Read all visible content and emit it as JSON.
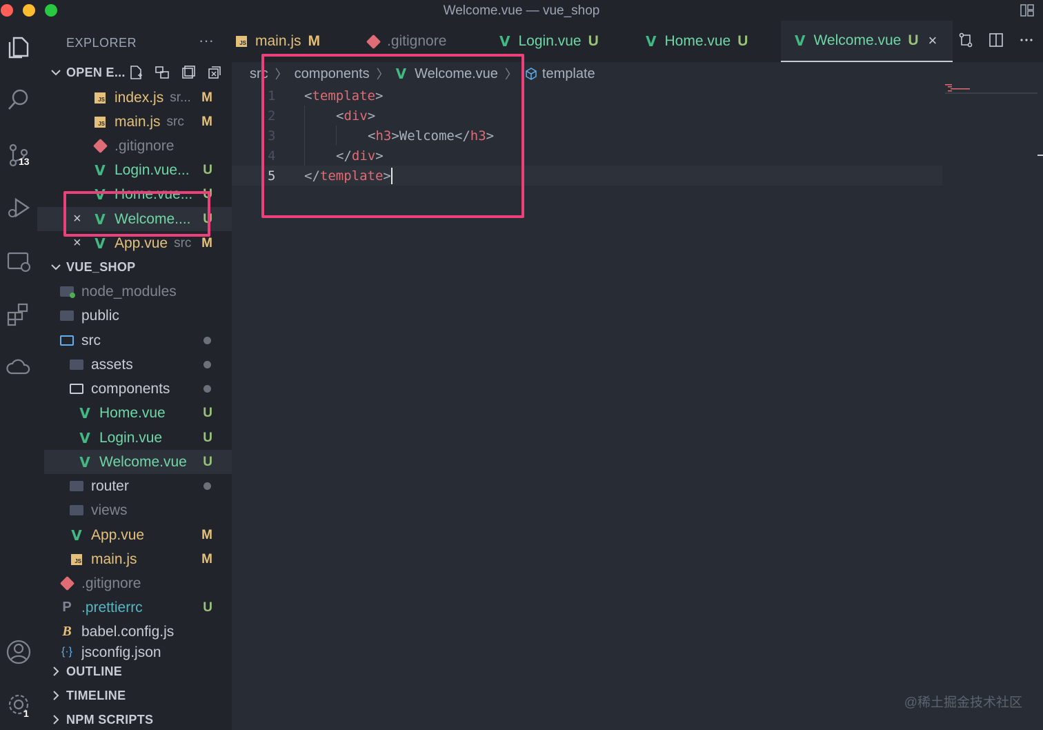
{
  "window": {
    "title": "Welcome.vue — vue_shop"
  },
  "activity_bar": {
    "items": [
      {
        "name": "explorer-icon"
      },
      {
        "name": "search-icon"
      },
      {
        "name": "source-control-icon",
        "badge": "13"
      },
      {
        "name": "run-debug-icon"
      },
      {
        "name": "remote-explorer-icon"
      },
      {
        "name": "extensions-icon"
      },
      {
        "name": "cloud-icon"
      }
    ],
    "bottom": [
      {
        "name": "account-icon"
      },
      {
        "name": "settings-icon",
        "badge": "1"
      }
    ]
  },
  "sidebar": {
    "header": "EXPLORER",
    "more": "···",
    "open_editors": {
      "title": "OPEN E...",
      "items": [
        {
          "label": "index.js",
          "desc": "sr...",
          "status": "M",
          "icon": "js"
        },
        {
          "label": "main.js",
          "desc": "src",
          "status": "M",
          "icon": "js"
        },
        {
          "label": ".gitignore",
          "desc": "",
          "status": "",
          "icon": "git"
        },
        {
          "label": "Login.vue...",
          "desc": "",
          "status": "U",
          "icon": "vue"
        },
        {
          "label": "Home.vue...",
          "desc": "",
          "status": "U",
          "icon": "vue"
        },
        {
          "label": "Welcome....",
          "desc": "",
          "status": "U",
          "icon": "vue",
          "close": "×"
        },
        {
          "label": "App.vue",
          "desc": "src",
          "status": "M",
          "icon": "vue",
          "close": "×"
        }
      ]
    },
    "project": {
      "title": "VUE_SHOP",
      "items": [
        {
          "label": "node_modules",
          "status": ""
        },
        {
          "label": "public",
          "status": ""
        },
        {
          "label": "src",
          "status": "dot"
        },
        {
          "label": "assets",
          "status": "dot"
        },
        {
          "label": "components",
          "status": "dot"
        },
        {
          "label": "Home.vue",
          "status": "U"
        },
        {
          "label": "Login.vue",
          "status": "U"
        },
        {
          "label": "Welcome.vue",
          "status": "U"
        },
        {
          "label": "router",
          "status": "dot"
        },
        {
          "label": "views",
          "status": ""
        },
        {
          "label": "App.vue",
          "status": "M"
        },
        {
          "label": "main.js",
          "status": "M"
        },
        {
          "label": ".gitignore",
          "status": ""
        },
        {
          "label": ".prettierrc",
          "status": "U"
        },
        {
          "label": "babel.config.js",
          "status": ""
        },
        {
          "label": "jsconfig.json",
          "status": ""
        }
      ]
    },
    "outline": "OUTLINE",
    "timeline": "TIMELINE",
    "npm_scripts": "NPM SCRIPTS"
  },
  "tabs": [
    {
      "label": "main.js",
      "status": "M",
      "icon": "js"
    },
    {
      "label": ".gitignore",
      "status": "",
      "icon": "git"
    },
    {
      "label": "Login.vue",
      "status": "U",
      "icon": "vue"
    },
    {
      "label": "Home.vue",
      "status": "U",
      "icon": "vue"
    },
    {
      "label": "Welcome.vue",
      "status": "U",
      "icon": "vue",
      "active": true,
      "close": "×"
    }
  ],
  "breadcrumbs": [
    "src",
    "components",
    "Welcome.vue",
    "template"
  ],
  "editor": {
    "lines": [
      {
        "num": "1",
        "open": "<",
        "tag": "template",
        "close": ">",
        "text": ""
      },
      {
        "num": "2",
        "open": "<",
        "tag": "div",
        "close": ">",
        "text": ""
      },
      {
        "num": "3",
        "open": "<",
        "tag": "h3",
        "close": ">",
        "text": "Welcome",
        "end_open": "</",
        "end_tag": "h3",
        "end_close": ">"
      },
      {
        "num": "4",
        "open": "</",
        "tag": "div",
        "close": ">",
        "text": ""
      },
      {
        "num": "5",
        "open": "</",
        "tag": "template",
        "close": ">",
        "text": ""
      }
    ],
    "cursor_line": 5
  },
  "watermark": "@稀土掘金技术社区",
  "colors": {
    "highlight": "#ec407a",
    "modified": "#e5c07b",
    "untracked": "#98c379",
    "vue": "#42b883"
  }
}
